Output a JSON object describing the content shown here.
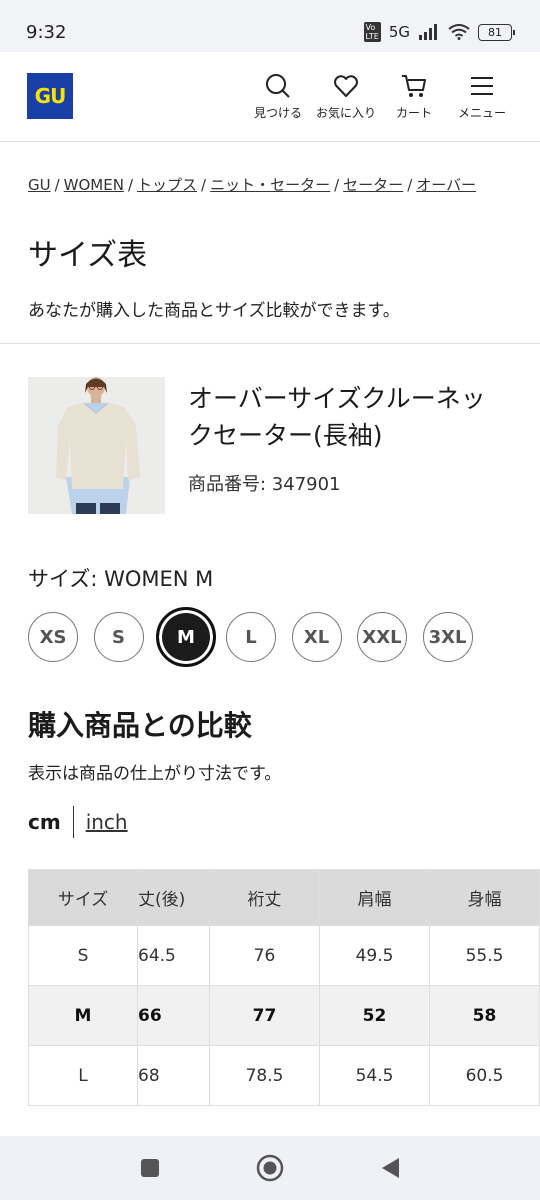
{
  "status_bar": {
    "time": "9:32",
    "network": "5G",
    "battery": "81"
  },
  "header": {
    "logo": "GU",
    "nav": [
      {
        "label": "見つける",
        "icon": "search-icon"
      },
      {
        "label": "お気に入り",
        "icon": "heart-icon"
      },
      {
        "label": "カート",
        "icon": "cart-icon"
      },
      {
        "label": "メニュー",
        "icon": "menu-icon"
      }
    ]
  },
  "breadcrumb": [
    "GU",
    "WOMEN",
    "トップス",
    "ニット・セーター",
    "セーター",
    "オーバー"
  ],
  "page": {
    "title": "サイズ表",
    "description": "あなたが購入した商品とサイズ比較ができます。"
  },
  "product": {
    "name": "オーバーサイズクルーネックセーター(長袖)",
    "code": "商品番号: 347901"
  },
  "size_selector": {
    "label": "サイズ: WOMEN M",
    "options": [
      "XS",
      "S",
      "M",
      "L",
      "XL",
      "XXL",
      "3XL"
    ],
    "selected": "M"
  },
  "comparison": {
    "title": "購入商品との比較",
    "note": "表示は商品の仕上がり寸法です。",
    "units": {
      "cm": "cm",
      "inch": "inch",
      "active": "cm"
    },
    "table": {
      "headers": [
        "サイズ",
        "丈(後)",
        "裄丈",
        "肩幅",
        "身幅"
      ],
      "rows": [
        [
          "S",
          "64.5",
          "76",
          "49.5",
          "55.5"
        ],
        [
          "M",
          "66",
          "77",
          "52",
          "58"
        ],
        [
          "L",
          "68",
          "78.5",
          "54.5",
          "60.5"
        ]
      ]
    }
  },
  "colors": {
    "brand_blue": "#1a3fa6",
    "brand_yellow": "#f7e300",
    "table_header": "#dadada",
    "selected_chip": "#1b1b1b"
  }
}
